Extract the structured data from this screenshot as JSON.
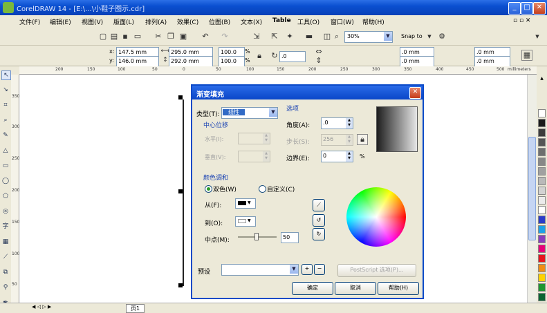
{
  "window": {
    "title": "CorelDRAW 14 - [E:\\...\\小鞋子图示.cdr]"
  },
  "menu": [
    "文件(F)",
    "编辑(E)",
    "视图(V)",
    "版面(L)",
    "排列(A)",
    "效果(C)",
    "位图(B)",
    "文本(X)",
    "Table",
    "工具(O)",
    "窗口(W)",
    "帮助(H)"
  ],
  "toolbar": {
    "zoom": "30%",
    "snap_to": "Snap to"
  },
  "properties": {
    "x": "147.5 mm",
    "y": "146.0 mm",
    "width": "295.0 mm",
    "height": "292.0 mm",
    "scale_x": "100.0",
    "scale_y": "100.0",
    "percent": "%",
    "angle": ".0",
    "pos_x2": ".0 mm",
    "pos_y2": ".0 mm",
    "pos_x3": ".0 mm",
    "pos_y3": ".0 mm"
  },
  "ruler": {
    "h_ticks": [
      "200",
      "150",
      "100",
      "50",
      "0",
      "50",
      "100",
      "150",
      "200",
      "250",
      "300",
      "350",
      "400",
      "450",
      "500"
    ],
    "unit": "millimeters",
    "v_ticks": [
      "350",
      "300",
      "250",
      "200",
      "150",
      "100",
      "50"
    ]
  },
  "dialog": {
    "title": "渐变填充",
    "type_label": "类型(T):",
    "type_value": "线性",
    "options_label": "选项",
    "center_offset_label": "中心位移",
    "horizontal_label": "水平(I):",
    "vertical_label": "垂直(V):",
    "angle_label": "角度(A):",
    "angle_value": ".0",
    "steps_label": "步长(S):",
    "steps_value": "256",
    "edge_pad_label": "边界(E):",
    "edge_pad_value": "0",
    "percent": "%",
    "color_blend_label": "颜色调和",
    "two_color_label": "双色(W)",
    "custom_label": "自定义(C)",
    "from_label": "从(F):",
    "to_label": "到(O):",
    "midpoint_label": "中点(M):",
    "midpoint_value": "50",
    "presets_label": "预设",
    "postscript_label": "PostScript 选项(P)...",
    "ok_label": "确定",
    "cancel_label": "取消",
    "help_label": "帮助(H)"
  },
  "status": {
    "page_tab": "页1"
  },
  "palette_colors": [
    "#ffffff",
    "#1a1a1a",
    "#3c3c3c",
    "#555555",
    "#6e6e6e",
    "#878787",
    "#a0a0a0",
    "#b9b9b9",
    "#d2d2d2",
    "#ebebeb",
    "#ffffff",
    "#2b3cc9",
    "#1ea0e6",
    "#8a3cbe",
    "#e60078",
    "#e6141e",
    "#f08c14",
    "#ffd200",
    "#1e9632",
    "#0a6432"
  ]
}
